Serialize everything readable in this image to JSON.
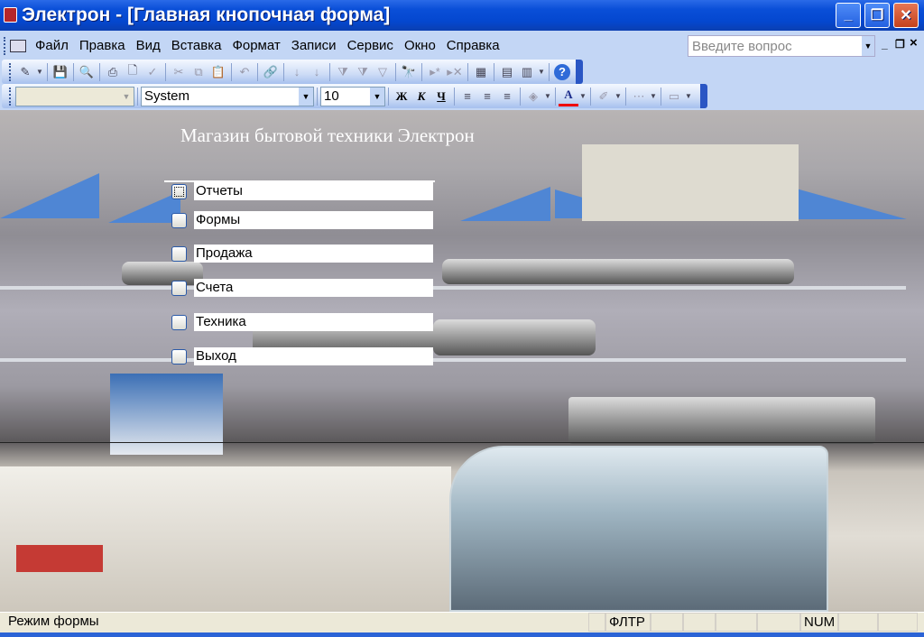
{
  "window": {
    "title": "Электрон - [Главная кнопочная форма]",
    "minimize": "_",
    "restore": "❐",
    "close": "✕"
  },
  "menu": [
    "Файл",
    "Правка",
    "Вид",
    "Вставка",
    "Формат",
    "Записи",
    "Сервис",
    "Окно",
    "Справка"
  ],
  "ask": {
    "placeholder": "Введите вопрос"
  },
  "mdi": {
    "minimize": "_",
    "restore": "❐",
    "close": "×"
  },
  "toolbar1": [
    {
      "name": "design-view",
      "g": "✎"
    },
    {
      "name": "save",
      "g": "💾"
    },
    {
      "name": "file-search",
      "g": "🔍"
    },
    {
      "name": "print",
      "g": "⎙"
    },
    {
      "name": "print-preview",
      "g": "🗋"
    },
    {
      "name": "spelling",
      "g": "✓"
    },
    {
      "name": "cut",
      "g": "✂"
    },
    {
      "name": "copy",
      "g": "⧉"
    },
    {
      "name": "paste",
      "g": "📋"
    },
    {
      "name": "undo",
      "g": "↶"
    },
    {
      "name": "hyperlink",
      "g": "🔗"
    },
    {
      "name": "sort-asc",
      "g": "↓"
    },
    {
      "name": "sort-desc",
      "g": "↓"
    },
    {
      "name": "filter-selection",
      "g": "⧩"
    },
    {
      "name": "filter-form",
      "g": "⧩"
    },
    {
      "name": "apply-filter",
      "g": "▽"
    },
    {
      "name": "find",
      "g": "🔭"
    },
    {
      "name": "new-record",
      "g": "▸*"
    },
    {
      "name": "delete-record",
      "g": "▸✕"
    },
    {
      "name": "properties",
      "g": "▦"
    },
    {
      "name": "database-window",
      "g": "▤"
    },
    {
      "name": "new-object",
      "g": "▥"
    },
    {
      "name": "help",
      "g": "?"
    }
  ],
  "toolbar2": {
    "object": "",
    "font": "System",
    "size": "10",
    "bold": "Ж",
    "italic": "К",
    "underline": "Ч",
    "align_left": "≡",
    "align_center": "≡",
    "align_right": "≡",
    "fill": "◈",
    "font_color": "A",
    "line_color": "✐",
    "border": "⋯",
    "line_width": "▭"
  },
  "form": {
    "title": "Магазин бытовой техники Электрон",
    "buttons": [
      "Отчеты",
      "Формы",
      "Продажа",
      "Счета",
      "Техника",
      "Выход"
    ]
  },
  "status": {
    "mode": "Режим формы",
    "filter": "ФЛТР",
    "num": "NUM"
  }
}
